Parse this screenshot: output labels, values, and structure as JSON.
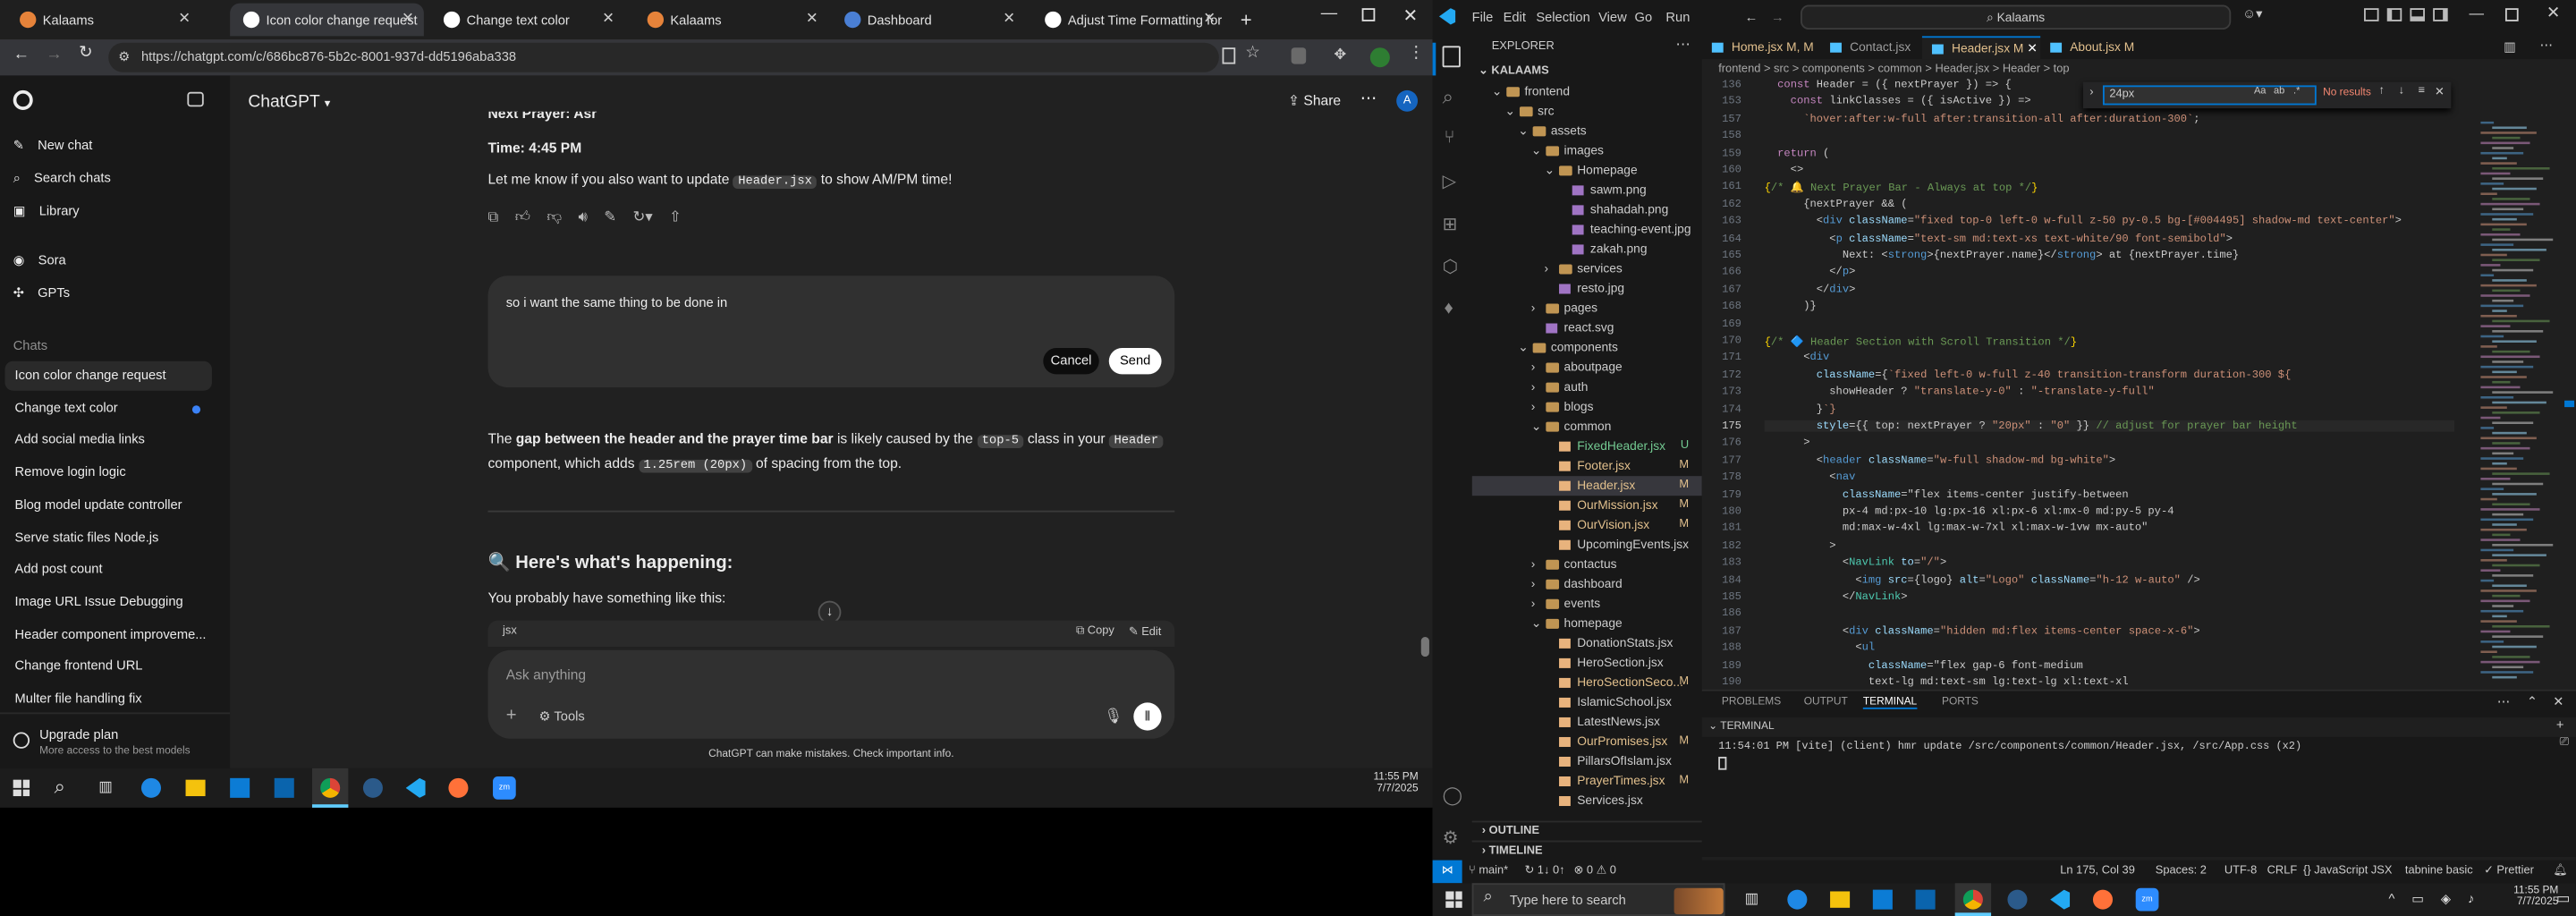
{
  "chrome": {
    "tabs": [
      {
        "title": "Kalaams",
        "fav": "#e6833a"
      },
      {
        "title": "Icon color change request",
        "fav": "#ffffff"
      },
      {
        "title": "Change text color",
        "fav": "#ffffff"
      },
      {
        "title": "Kalaams",
        "fav": "#e6833a"
      },
      {
        "title": "Dashboard",
        "fav": "#4a7fd4"
      },
      {
        "title": "Adjust Time Formatting for",
        "fav": "#ffffff"
      }
    ],
    "url": "https://chatgpt.com/c/686bc876-5b2c-8001-937d-dd5196aba338"
  },
  "chatgpt": {
    "sidebar": {
      "new_chat": "New chat",
      "search_chats": "Search chats",
      "library": "Library",
      "sora": "Sora",
      "gpts": "GPTs",
      "chats_header": "Chats",
      "chats": [
        "Icon color change request",
        "Change text color",
        "Add social media links",
        "Remove login logic",
        "Blog model update controller",
        "Serve static files Node.js",
        "Add post count",
        "Image URL Issue Debugging",
        "Header component improveme...",
        "Change frontend URL",
        "Multer file handling fix"
      ],
      "upgrade_title": "Upgrade plan",
      "upgrade_sub": "More access to the best models"
    },
    "header": {
      "model": "ChatGPT",
      "share": "Share",
      "avatar": "A"
    },
    "conversation": {
      "prayer_partial": "Next Prayer: Asr",
      "time_line": "Time: 4:45 PM",
      "let_me_know_a": "Let me know if you also want to update ",
      "let_me_know_code": "Header.jsx",
      "let_me_know_b": " to show AM/PM time!",
      "edit_text": "so i want the same thing to be done in",
      "cancel": "Cancel",
      "send": "Send",
      "p1_a": "The ",
      "p1_b": "gap between the header and the prayer time bar",
      "p1_c": " is likely caused by the ",
      "p1_code1": "top-5",
      "p1_d": " class in your ",
      "p1_code2": "Header",
      "p2_a": "component, which adds ",
      "p2_code": "1.25rem (20px)",
      "p2_b": " of spacing from the top.",
      "heading": "🔍 Here's what's happening:",
      "probably": "You probably have something like this:",
      "code_lang": "jsx",
      "copy": "Copy",
      "edit": "Edit"
    },
    "composer": {
      "placeholder": "Ask anything",
      "tools": "Tools"
    },
    "disclaimer": "ChatGPT can make mistakes. Check important info."
  },
  "win_taskbar_left": {
    "time": "11:55 PM",
    "date": "7/7/2025"
  },
  "vscode": {
    "menu": [
      "File",
      "Edit",
      "Selection",
      "View",
      "Go",
      "Run"
    ],
    "search": "Kalaams",
    "explorer_title": "EXPLORER",
    "root": "KALAAMS",
    "tree": [
      {
        "d": 1,
        "n": "frontend",
        "t": "open"
      },
      {
        "d": 2,
        "n": "src",
        "t": "open"
      },
      {
        "d": 3,
        "n": "assets",
        "t": "open"
      },
      {
        "d": 4,
        "n": "images",
        "t": "open"
      },
      {
        "d": 5,
        "n": "Homepage",
        "t": "open"
      },
      {
        "d": 6,
        "n": "sawm.png",
        "t": "img"
      },
      {
        "d": 6,
        "n": "shahadah.png",
        "t": "img"
      },
      {
        "d": 6,
        "n": "teaching-event.jpg",
        "t": "img"
      },
      {
        "d": 6,
        "n": "zakah.png",
        "t": "img"
      },
      {
        "d": 5,
        "n": "services",
        "t": "closed"
      },
      {
        "d": 5,
        "n": "resto.jpg",
        "t": "img"
      },
      {
        "d": 4,
        "n": "pages",
        "t": "closed"
      },
      {
        "d": 4,
        "n": "react.svg",
        "t": "img"
      },
      {
        "d": 3,
        "n": "components",
        "t": "open"
      },
      {
        "d": 4,
        "n": "aboutpage",
        "t": "closed"
      },
      {
        "d": 4,
        "n": "auth",
        "t": "closed"
      },
      {
        "d": 4,
        "n": "blogs",
        "t": "closed"
      },
      {
        "d": 4,
        "n": "common",
        "t": "open"
      },
      {
        "d": 5,
        "n": "FixedHeader.jsx",
        "t": "jsx",
        "b": "U"
      },
      {
        "d": 5,
        "n": "Footer.jsx",
        "t": "jsx",
        "b": "M"
      },
      {
        "d": 5,
        "n": "Header.jsx",
        "t": "jsx",
        "b": "M",
        "sel": true
      },
      {
        "d": 5,
        "n": "OurMission.jsx",
        "t": "jsx",
        "b": "M"
      },
      {
        "d": 5,
        "n": "OurVision.jsx",
        "t": "jsx",
        "b": "M"
      },
      {
        "d": 5,
        "n": "UpcomingEvents.jsx",
        "t": "jsx"
      },
      {
        "d": 4,
        "n": "contactus",
        "t": "closed"
      },
      {
        "d": 4,
        "n": "dashboard",
        "t": "closed"
      },
      {
        "d": 4,
        "n": "events",
        "t": "closed"
      },
      {
        "d": 4,
        "n": "homepage",
        "t": "open"
      },
      {
        "d": 5,
        "n": "DonationStats.jsx",
        "t": "jsx"
      },
      {
        "d": 5,
        "n": "HeroSection.jsx",
        "t": "jsx"
      },
      {
        "d": 5,
        "n": "HeroSectionSeco...",
        "t": "jsx",
        "b": "M"
      },
      {
        "d": 5,
        "n": "IslamicSchool.jsx",
        "t": "jsx"
      },
      {
        "d": 5,
        "n": "LatestNews.jsx",
        "t": "jsx"
      },
      {
        "d": 5,
        "n": "OurPromises.jsx",
        "t": "jsx",
        "b": "M"
      },
      {
        "d": 5,
        "n": "PillarsOfIslam.jsx",
        "t": "jsx"
      },
      {
        "d": 5,
        "n": "PrayerTimes.jsx",
        "t": "jsx",
        "b": "M"
      },
      {
        "d": 5,
        "n": "Services.jsx",
        "t": "jsx"
      }
    ],
    "outline": "OUTLINE",
    "timeline": "TIMELINE",
    "tabs": [
      {
        "n": "Home.jsx",
        "s": " M, M"
      },
      {
        "n": "Contact.jsx",
        "s": ""
      },
      {
        "n": "Header.jsx",
        "s": " M"
      },
      {
        "n": "About.jsx",
        "s": " M"
      }
    ],
    "breadcrumb": "frontend > src > components > common > Header.jsx > Header > top",
    "find_value": "24px",
    "find_result": "No results",
    "code": [
      [
        "136",
        "  const Header = ({ nextPrayer }) => {"
      ],
      [
        "153",
        "    const linkClasses = ({ isActive }) =>"
      ],
      [
        "157",
        "      `hover:after:w-full after:transition-all after:duration-300`;"
      ],
      [
        "158",
        ""
      ],
      [
        "159",
        "  return ("
      ],
      [
        "160",
        "    <>"
      ],
      [
        "161",
        "      {/* 🔔 Next Prayer Bar - Always at top */}"
      ],
      [
        "162",
        "      {nextPrayer && ("
      ],
      [
        "163",
        "        <div className=\"fixed top-0 left-0 w-full z-50 py-0.5 bg-[#004495] shadow-md text-center\">"
      ],
      [
        "164",
        "          <p className=\"text-sm md:text-xs text-white/90 font-semibold\">"
      ],
      [
        "165",
        "            Next: <strong>{nextPrayer.name}</strong> at {nextPrayer.time}"
      ],
      [
        "166",
        "          </p>"
      ],
      [
        "167",
        "        </div>"
      ],
      [
        "168",
        "      )}"
      ],
      [
        "169",
        ""
      ],
      [
        "170",
        "      {/* 🔷 Header Section with Scroll Transition */}"
      ],
      [
        "171",
        "      <div"
      ],
      [
        "172",
        "        className={`fixed left-0 w-full z-40 transition-transform duration-300 ${"
      ],
      [
        "173",
        "          showHeader ? \"translate-y-0\" : \"-translate-y-full\""
      ],
      [
        "174",
        "        }`}"
      ],
      [
        "175",
        "        style={{ top: nextPrayer ? \"20px\" : \"0\" }} // adjust for prayer bar height"
      ],
      [
        "176",
        "      >"
      ],
      [
        "177",
        "        <header className=\"w-full shadow-md bg-white\">"
      ],
      [
        "178",
        "          <nav"
      ],
      [
        "179",
        "            className=\"flex items-center justify-between"
      ],
      [
        "180",
        "            px-4 md:px-10 lg:px-16 xl:px-6 xl:mx-0 md:py-5 py-4"
      ],
      [
        "181",
        "            md:max-w-4xl lg:max-w-7xl xl:max-w-1vw mx-auto\""
      ],
      [
        "182",
        "          >"
      ],
      [
        "183",
        "            <NavLink to=\"/\">"
      ],
      [
        "184",
        "              <img src={logo} alt=\"Logo\" className=\"h-12 w-auto\" />"
      ],
      [
        "185",
        "            </NavLink>"
      ],
      [
        "186",
        ""
      ],
      [
        "187",
        "            <div className=\"hidden md:flex items-center space-x-6\">"
      ],
      [
        "188",
        "              <ul"
      ],
      [
        "189",
        "                className=\"flex gap-6 font-medium"
      ],
      [
        "190",
        "                text-lg md:text-sm lg:text-lg xl:text-xl"
      ]
    ],
    "panel_tabs": [
      "PROBLEMS",
      "OUTPUT",
      "TERMINAL",
      "PORTS"
    ],
    "terminal_title": "TERMINAL",
    "terminal_line": "11:54:01 PM [vite] (client) hmr update /src/components/common/Header.jsx, /src/App.css (x2)",
    "status": {
      "branch": "main*",
      "sync": "↻ 1↓ 0↑",
      "problems": "⊗ 0 ⚠ 0",
      "position": "Ln 175, Col 39",
      "spaces": "Spaces: 2",
      "encoding": "UTF-8",
      "eol": "CRLF",
      "language": "JavaScript JSX",
      "tabnine": "tabnine basic",
      "prettier": "✓ Prettier"
    }
  },
  "win_taskbar_right": {
    "search_placeholder": "Type here to search",
    "time": "11:55 PM",
    "date": "7/7/2025"
  }
}
